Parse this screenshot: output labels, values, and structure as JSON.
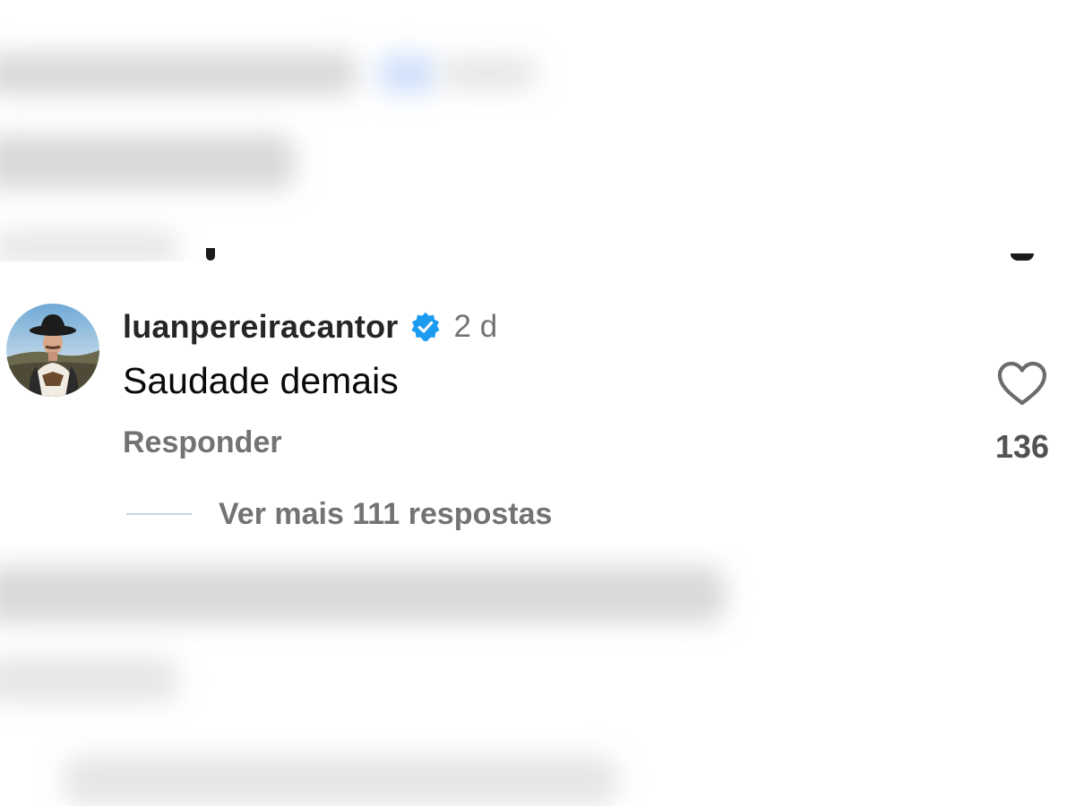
{
  "comment": {
    "username": "luanpereiracantor",
    "verified": true,
    "timestamp": "2 d",
    "text": "Saudade demais",
    "reply_label": "Responder",
    "like_count": "136",
    "view_replies_label": "Ver mais 111 respostas"
  },
  "icons": {
    "verified": "verified-badge-icon",
    "like": "heart-outline-icon"
  },
  "colors": {
    "verified_blue": "#1d9bf0",
    "secondary_text": "#737373",
    "primary_text": "#262626"
  }
}
